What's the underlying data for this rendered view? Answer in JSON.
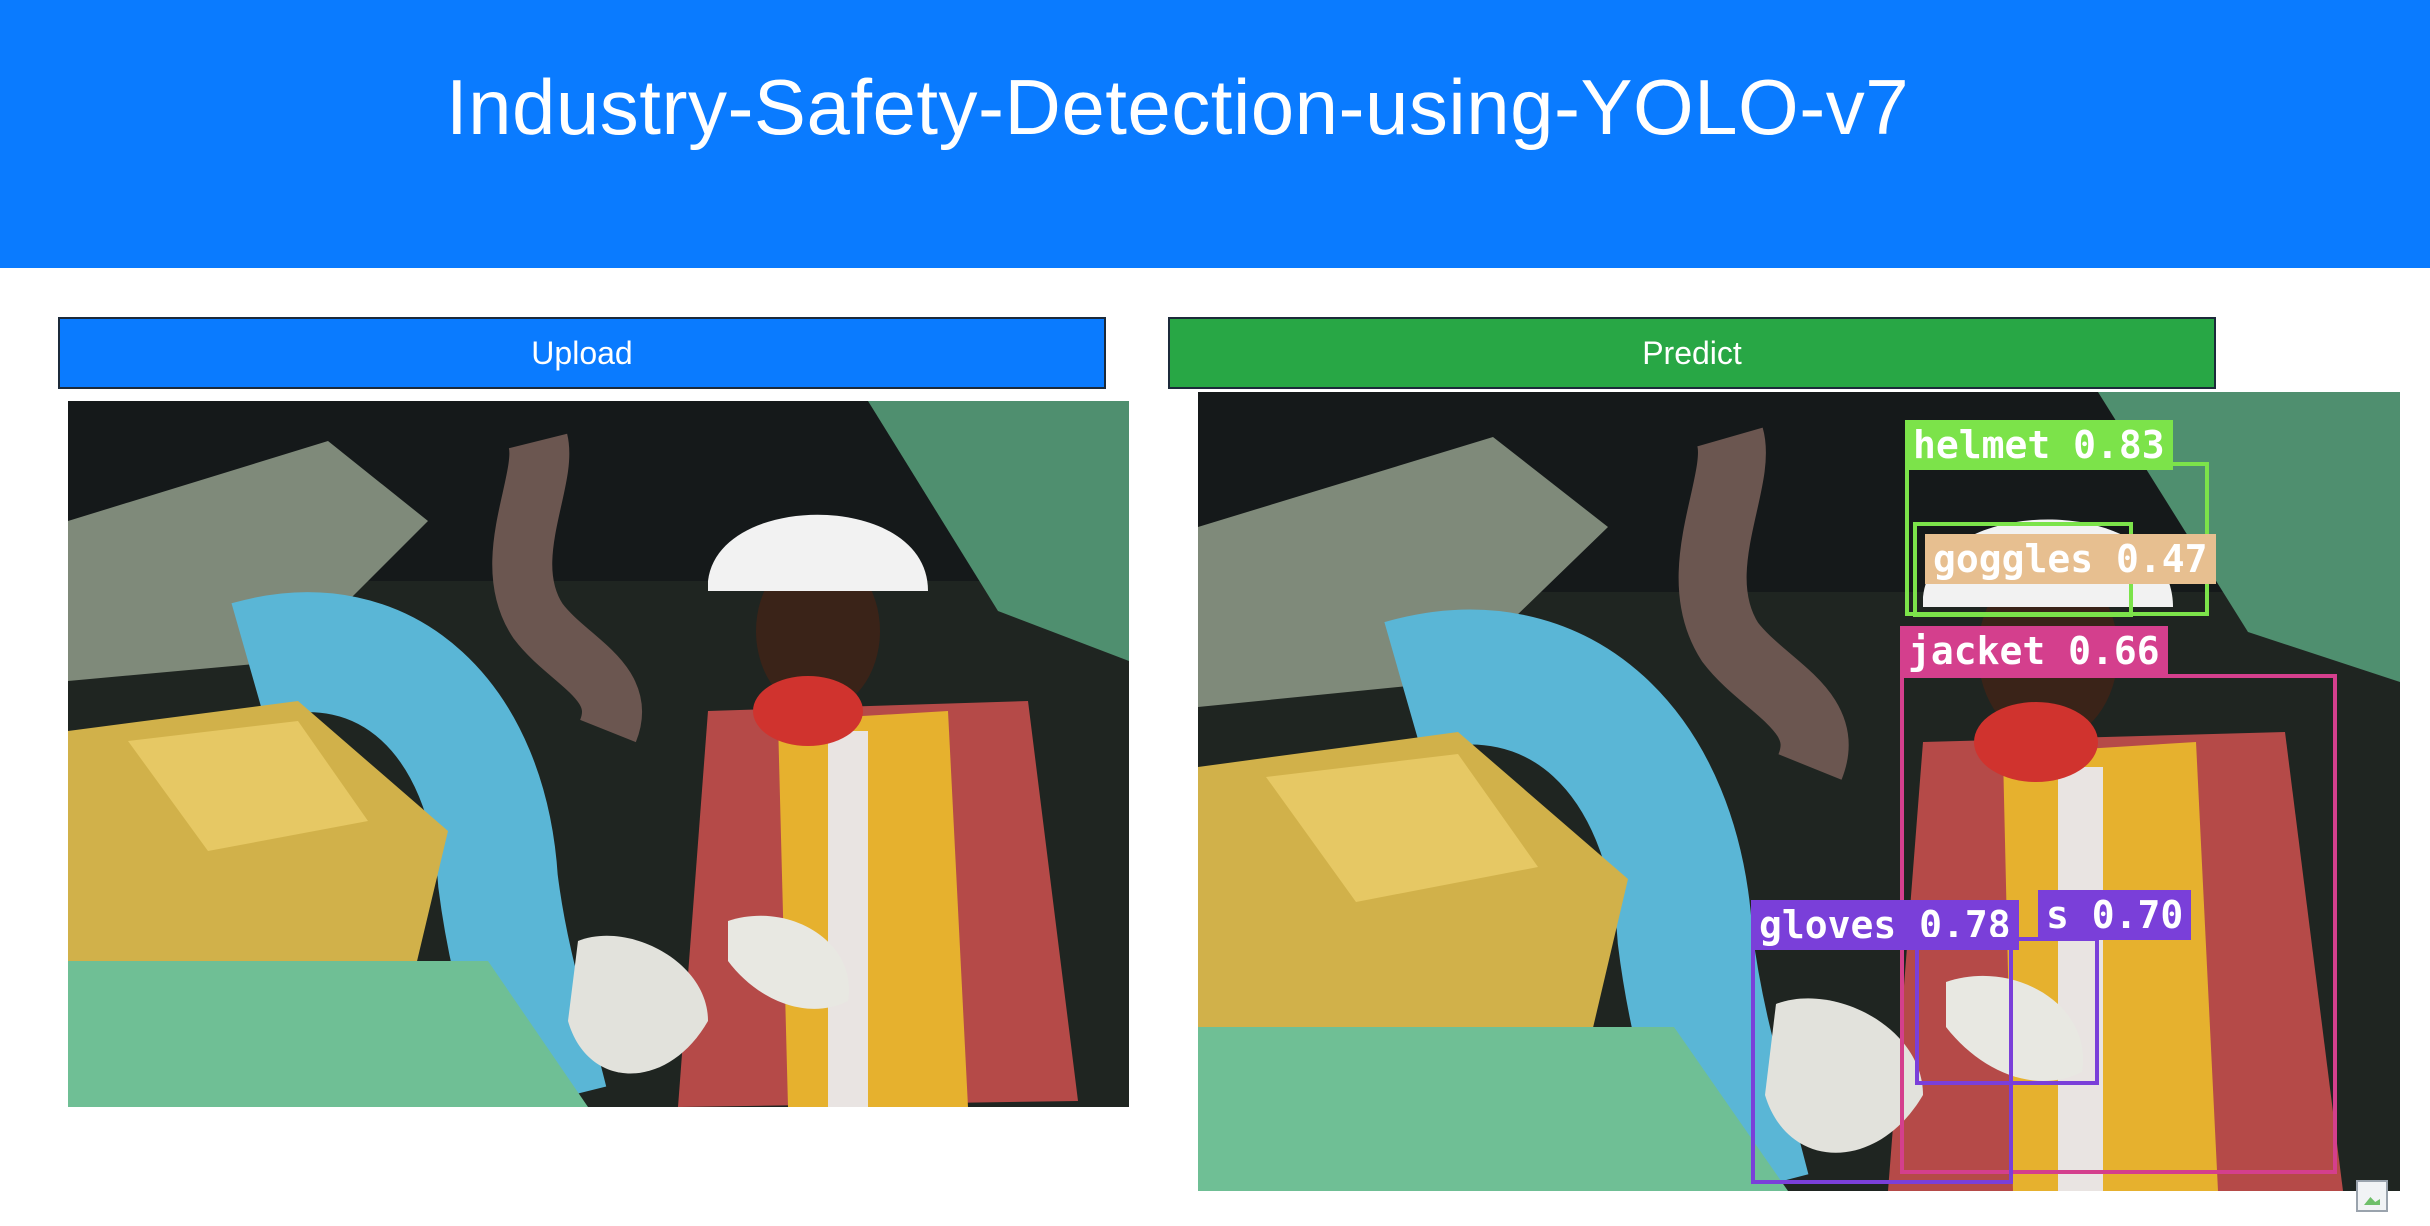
{
  "header": {
    "title": "Industry-Safety-Detection-using-YOLO-v7"
  },
  "buttons": {
    "upload_label": "Upload",
    "predict_label": "Predict"
  },
  "images": {
    "uploaded_alt": "uploaded image",
    "predicted_alt": "predicted image"
  },
  "detections": [
    {
      "label": "helmet 0.83",
      "color": "#7ce34a"
    },
    {
      "label": "goggles 0.47",
      "color": "#e7bf90"
    },
    {
      "label": "jacket 0.66",
      "color": "#d43f8d"
    },
    {
      "label": "gloves 0.78",
      "color": "#7a3fd9"
    },
    {
      "label": "s 0.70",
      "color": "#7a3fd9"
    }
  ],
  "colors": {
    "header_bg": "#0a7bff",
    "upload_bg": "#0a7bff",
    "predict_bg": "#28a745"
  }
}
